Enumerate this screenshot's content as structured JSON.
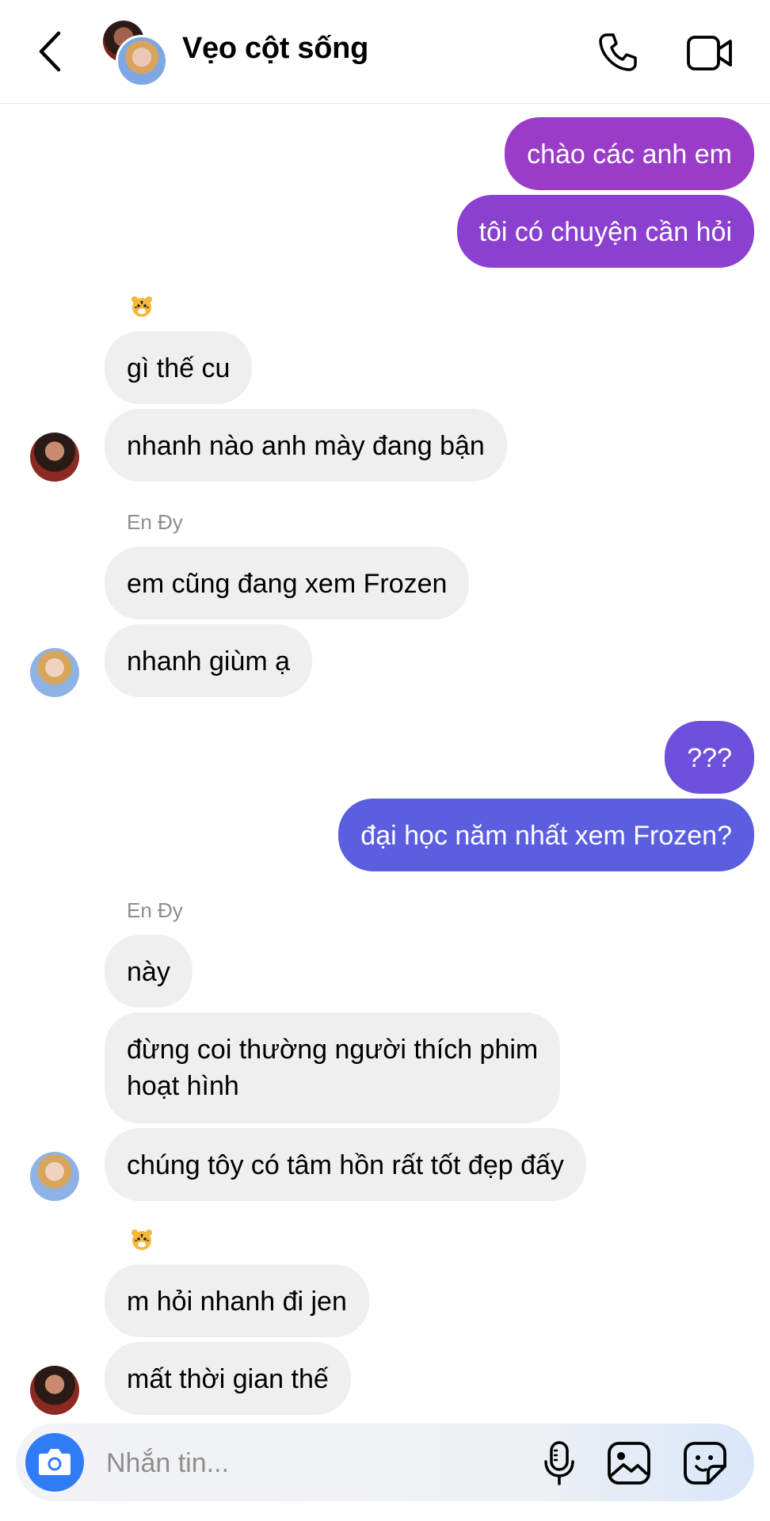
{
  "header": {
    "title": "Vẹo cột sống"
  },
  "messages": {
    "out1": "chào các anh em",
    "out2": "tôi có chuyện cần hỏi",
    "in1": "gì thế cu",
    "in2": "nhanh nào anh mày đang bận",
    "sender_en_dy": "En Đy",
    "in3": "em cũng đang xem Frozen",
    "in4": "nhanh giùm ạ",
    "out3": "???",
    "out4": "đại học năm nhất xem Frozen?",
    "sender_en_dy_2": "En Đy",
    "in5": "này",
    "in6_line1": "đừng coi thường người thích phim",
    "in6_line2": "hoạt hình",
    "in7": "chúng tôy có tâm hồn rất tốt đẹp đấy",
    "in8": "m hỏi nhanh đi jen",
    "in9": "mất thời gian thế"
  },
  "composer": {
    "placeholder": "Nhắn tin..."
  },
  "colors": {
    "out_purple": "#9a3cc8",
    "out_violet": "#7a4fd8",
    "out_indigo": "#5c5ee0",
    "in_gray": "#efefef"
  },
  "icons": {
    "back": "chevron-left-icon",
    "call": "phone-icon",
    "video": "video-camera-icon",
    "camera": "camera-icon",
    "mic": "microphone-icon",
    "gallery": "image-icon",
    "sticker": "sticker-icon",
    "tiger": "tiger-face-icon"
  }
}
